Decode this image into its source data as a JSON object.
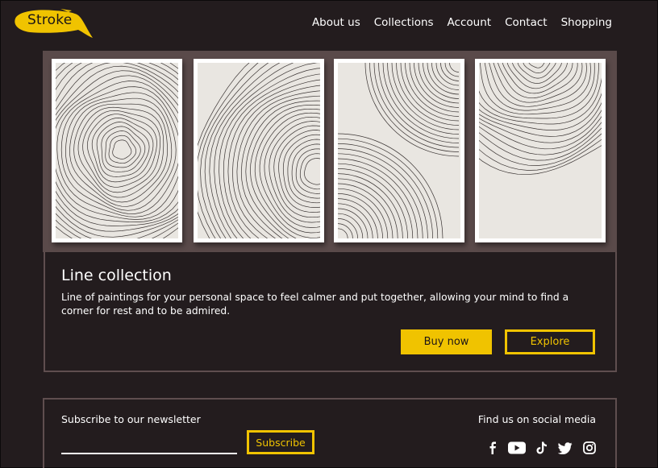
{
  "header": {
    "logo_text": "Stroke",
    "nav": [
      "About us",
      "Collections",
      "Account",
      "Contact",
      "Shopping"
    ]
  },
  "colors": {
    "background": "#231c1e",
    "accent": "#f0c300",
    "frame": "#5a4a4a",
    "art_paper": "#e9e6e1"
  },
  "hero": {
    "artworks": [
      "concentric-rings-art",
      "arc-lines-art",
      "quarter-arcs-art",
      "dome-lines-art"
    ]
  },
  "collection": {
    "title": "Line collection",
    "description": "Line of paintings for your personal space to feel calmer and put together, allowing your mind to find a corner for rest and to be admired.",
    "buy_label": "Buy now",
    "explore_label": "Explore"
  },
  "newsletter": {
    "label": "Subscribe to our newsletter",
    "input_value": "",
    "subscribe_label": "Subscribe"
  },
  "social": {
    "label": "Find us on social media",
    "icons": [
      "facebook-icon",
      "youtube-icon",
      "tiktok-icon",
      "twitter-icon",
      "instagram-icon"
    ]
  }
}
